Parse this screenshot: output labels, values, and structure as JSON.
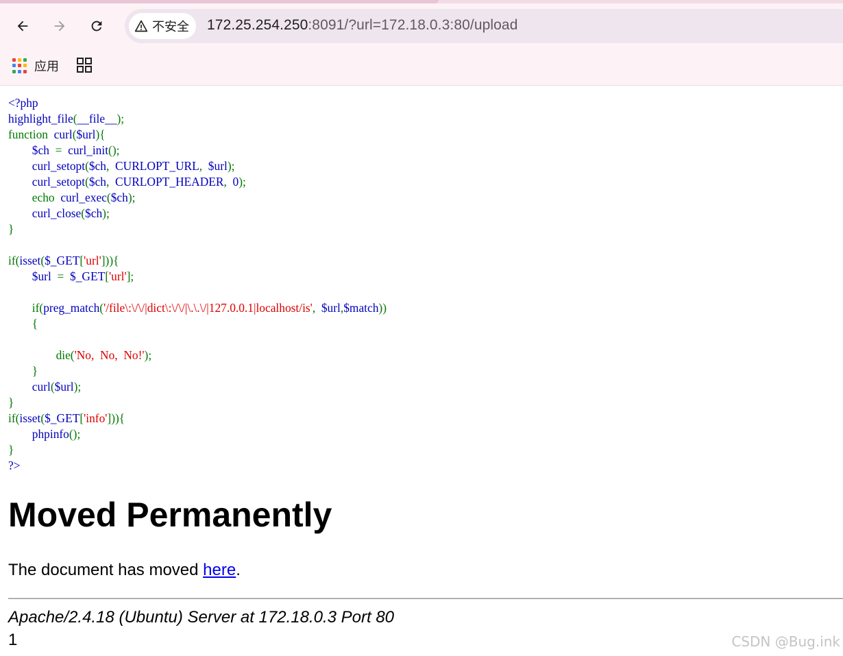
{
  "browser": {
    "security_label": "不安全",
    "url_host": "172.25.254.250",
    "url_rest": ":8091/?url=172.18.0.3:80/upload",
    "bookmarks": {
      "apps_label": "应用"
    },
    "apps_grid_colors": [
      "#ea4335",
      "#fbbc04",
      "#34a853",
      "#4285f4",
      "#ea4335",
      "#fbbc04",
      "#34a853",
      "#4285f4",
      "#ea4335"
    ]
  },
  "colors": {
    "php_default": "#0000bb",
    "php_keyword": "#007700",
    "php_string": "#dd0000",
    "link": "#0000ee"
  },
  "code": {
    "lines": [
      [
        [
          "d",
          "<?php"
        ]
      ],
      [
        [
          "d",
          "highlight_file"
        ],
        [
          "k",
          "("
        ],
        [
          "d",
          "__file__"
        ],
        [
          "k",
          ");"
        ]
      ],
      [
        [
          "k",
          "function  "
        ],
        [
          "d",
          "curl"
        ],
        [
          "k",
          "("
        ],
        [
          "d",
          "$url"
        ],
        [
          "k",
          "){"
        ]
      ],
      [
        [
          "k",
          "        "
        ],
        [
          "d",
          "$ch  "
        ],
        [
          "k",
          "=  "
        ],
        [
          "d",
          "curl_init"
        ],
        [
          "k",
          "();"
        ]
      ],
      [
        [
          "k",
          "        "
        ],
        [
          "d",
          "curl_setopt"
        ],
        [
          "k",
          "("
        ],
        [
          "d",
          "$ch"
        ],
        [
          "k",
          ",  "
        ],
        [
          "d",
          "CURLOPT_URL"
        ],
        [
          "k",
          ",  "
        ],
        [
          "d",
          "$url"
        ],
        [
          "k",
          ");"
        ]
      ],
      [
        [
          "k",
          "        "
        ],
        [
          "d",
          "curl_setopt"
        ],
        [
          "k",
          "("
        ],
        [
          "d",
          "$ch"
        ],
        [
          "k",
          ",  "
        ],
        [
          "d",
          "CURLOPT_HEADER"
        ],
        [
          "k",
          ",  "
        ],
        [
          "d",
          "0"
        ],
        [
          "k",
          ");"
        ]
      ],
      [
        [
          "k",
          "        echo  "
        ],
        [
          "d",
          "curl_exec"
        ],
        [
          "k",
          "("
        ],
        [
          "d",
          "$ch"
        ],
        [
          "k",
          ");"
        ]
      ],
      [
        [
          "k",
          "        "
        ],
        [
          "d",
          "curl_close"
        ],
        [
          "k",
          "("
        ],
        [
          "d",
          "$ch"
        ],
        [
          "k",
          ");"
        ]
      ],
      [
        [
          "k",
          "}"
        ]
      ],
      [
        [
          "k",
          ""
        ]
      ],
      [
        [
          "k",
          "if("
        ],
        [
          "d",
          "isset"
        ],
        [
          "k",
          "("
        ],
        [
          "d",
          "$_GET"
        ],
        [
          "k",
          "["
        ],
        [
          "s",
          "'url'"
        ],
        [
          "k",
          "])){"
        ]
      ],
      [
        [
          "k",
          "        "
        ],
        [
          "d",
          "$url  "
        ],
        [
          "k",
          "=  "
        ],
        [
          "d",
          "$_GET"
        ],
        [
          "k",
          "["
        ],
        [
          "s",
          "'url'"
        ],
        [
          "k",
          "];"
        ]
      ],
      [
        [
          "k",
          ""
        ]
      ],
      [
        [
          "k",
          "        if("
        ],
        [
          "d",
          "preg_match"
        ],
        [
          "k",
          "("
        ],
        [
          "s",
          "'/file\\:\\/\\/|dict\\:\\/\\/|\\.\\.\\/|127.0.0.1|localhost/is'"
        ],
        [
          "k",
          ",  "
        ],
        [
          "d",
          "$url"
        ],
        [
          "k",
          ","
        ],
        [
          "d",
          "$match"
        ],
        [
          "k",
          "))"
        ]
      ],
      [
        [
          "k",
          "        {"
        ]
      ],
      [
        [
          "k",
          ""
        ]
      ],
      [
        [
          "k",
          "                die("
        ],
        [
          "s",
          "'No,  No,  No!'"
        ],
        [
          "k",
          ");"
        ]
      ],
      [
        [
          "k",
          "        }"
        ]
      ],
      [
        [
          "k",
          "        "
        ],
        [
          "d",
          "curl"
        ],
        [
          "k",
          "("
        ],
        [
          "d",
          "$url"
        ],
        [
          "k",
          ");"
        ]
      ],
      [
        [
          "k",
          "}"
        ]
      ],
      [
        [
          "k",
          "if("
        ],
        [
          "d",
          "isset"
        ],
        [
          "k",
          "("
        ],
        [
          "d",
          "$_GET"
        ],
        [
          "k",
          "["
        ],
        [
          "s",
          "'info'"
        ],
        [
          "k",
          "])){"
        ]
      ],
      [
        [
          "k",
          "        "
        ],
        [
          "d",
          "phpinfo"
        ],
        [
          "k",
          "();"
        ]
      ],
      [
        [
          "k",
          "}"
        ]
      ],
      [
        [
          "d",
          "?>"
        ]
      ]
    ]
  },
  "response": {
    "heading": "Moved Permanently",
    "text_before": "The document has moved ",
    "link_text": "here",
    "text_after": ".",
    "address": "Apache/2.4.18 (Ubuntu) Server at 172.18.0.3 Port 80",
    "trailing_output": "1"
  },
  "watermark": "CSDN @Bug.ink"
}
